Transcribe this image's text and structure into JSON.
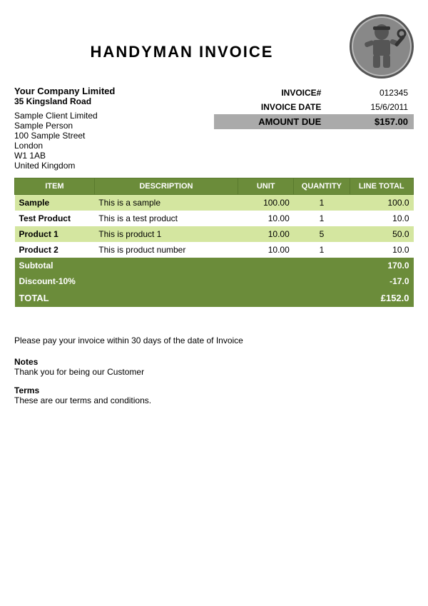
{
  "header": {
    "title": "HANDYMAN INVOICE"
  },
  "company": {
    "name": "Your Company Limited",
    "street": "35 Kingsland Road",
    "city": ""
  },
  "client": {
    "company": "Sample Client Limited",
    "person": "Sample Person",
    "address1": "100 Sample Street",
    "address2": "London",
    "address3": "W1 1AB",
    "address4": "United Kingdom"
  },
  "invoice": {
    "number_label": "INVOICE#",
    "number_value": "012345",
    "date_label": "INVOICE DATE",
    "date_value": "15/6/2011",
    "amount_label": "AMOUNT DUE",
    "amount_value": "$157.00"
  },
  "table": {
    "headers": [
      "ITEM",
      "DESCRIPTION",
      "UNIT",
      "QUANTITY",
      "LINE TOTAL"
    ],
    "rows": [
      {
        "item": "Sample",
        "description": "This is a sample",
        "unit": "100.00",
        "quantity": "1",
        "total": "100.0",
        "alt": true
      },
      {
        "item": "Test Product",
        "description": "This is a test product",
        "unit": "10.00",
        "quantity": "1",
        "total": "10.0",
        "alt": false
      },
      {
        "item": "Product 1",
        "description": "This is product 1",
        "unit": "10.00",
        "quantity": "5",
        "total": "50.0",
        "alt": true
      },
      {
        "item": "Product 2",
        "description": "This is product number",
        "unit": "10.00",
        "quantity": "1",
        "total": "10.0",
        "alt": false
      }
    ],
    "subtotal_label": "Subtotal",
    "subtotal_value": "170.0",
    "discount_label": "Discount-10%",
    "discount_value": "-17.0",
    "total_label": "TOTAL",
    "total_value": "£152.0"
  },
  "footer": {
    "payment_text": "Please pay your invoice within 30 days of the date of Invoice",
    "notes_title": "Notes",
    "notes_text": "Thank you for being our Customer",
    "terms_title": "Terms",
    "terms_text": "These are our terms and conditions."
  }
}
